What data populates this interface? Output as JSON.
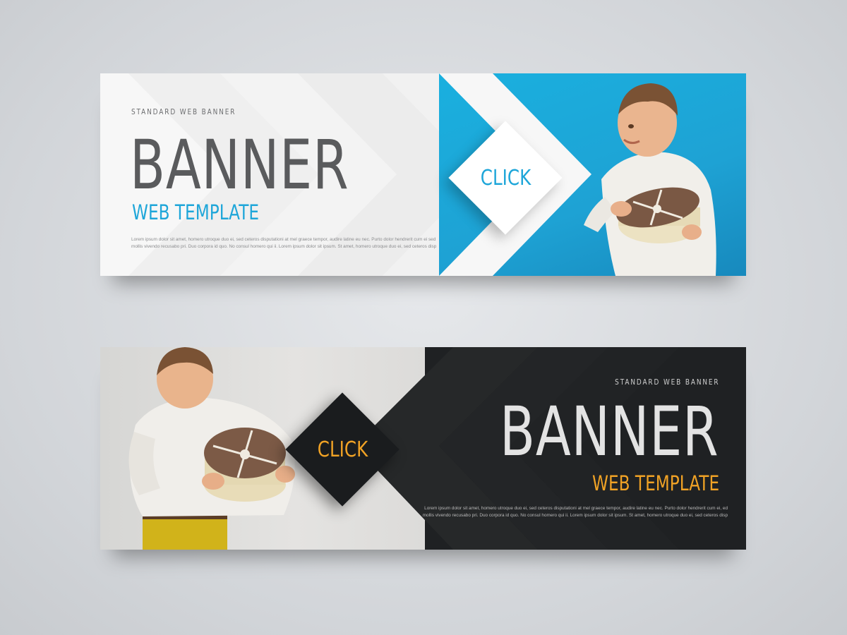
{
  "banners": [
    {
      "eyebrow": "STANDARD WEB BANNER",
      "title": "BANNER",
      "subtitle": "WEB TEMPLATE",
      "button_label": "CLICK",
      "body_lines": [
        "Lorem ipsum dolor sit amet, homero utroque duo ei, sed ceteros disputationi at mel graece tempor, audire latine eu nec. Purto dolor hendrerit cum ei sed",
        "mollis vivendo recusabo pri. Duo corpora id quo. No consul homero qui ii. Lorem ipsum dolor sit ipsum. St amet, homero utroque duo ei, sed ceteros disp"
      ],
      "theme": "light",
      "accent_color": "#1ea6d9",
      "title_color": "#5a5b5d"
    },
    {
      "eyebrow": "STANDARD WEB BANNER",
      "title": "BANNER",
      "subtitle": "WEB TEMPLATE",
      "button_label": "CLICK",
      "body_lines": [
        "Lorem ipsum dolor sit amet, homero utroque duo ei, sed ceteros disputationi at mel graece tempor, audire latine eu nec. Purto dolor hendrerit cum ei, ed",
        "mollis vivendo recusabo pri. Duo corpora id quo. No consul homero qui ii. Lorem ipsum dolor sit ipsum. St amet, homero utroque duo ei, sed ceteros disp"
      ],
      "theme": "dark",
      "accent_color": "#f0a225",
      "title_color": "#e3e3e3"
    }
  ]
}
